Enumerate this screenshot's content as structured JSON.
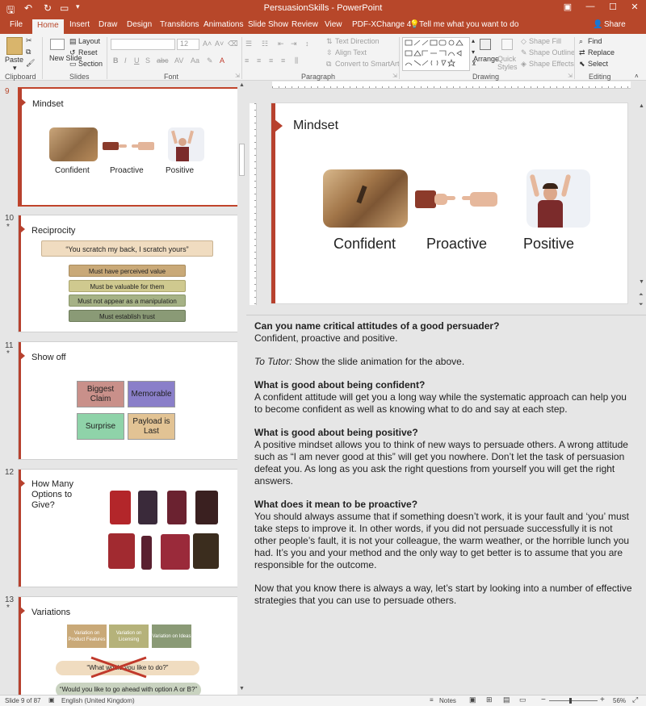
{
  "titlebar": {
    "title": "PersuasionSkills  -  PowerPoint"
  },
  "tabs": [
    "File",
    "Home",
    "Insert",
    "Draw",
    "Design",
    "Transitions",
    "Animations",
    "Slide Show",
    "Review",
    "View",
    "PDF-XChange 4"
  ],
  "tell_me": "Tell me what you want to do",
  "share": "Share",
  "ribbon": {
    "paste": "Paste",
    "new_slide": "New Slide",
    "layout": "Layout",
    "reset": "Reset",
    "section": "Section",
    "font_size": "12",
    "text_direction": "Text Direction",
    "align_text": "Align Text",
    "convert_smartart": "Convert to SmartArt",
    "arrange": "Arrange",
    "quick_styles": "Quick Styles",
    "shape_fill": "Shape Fill",
    "shape_outline": "Shape Outline",
    "shape_effects": "Shape Effects",
    "find": "Find",
    "replace": "Replace",
    "select": "Select",
    "groups": {
      "clipboard": "Clipboard",
      "slides": "Slides",
      "font": "Font",
      "paragraph": "Paragraph",
      "drawing": "Drawing",
      "editing": "Editing"
    }
  },
  "thumbnails": [
    {
      "num": "9",
      "title": "Mindset",
      "labels": [
        "Confident",
        "Proactive",
        "Positive"
      ]
    },
    {
      "num": "10",
      "star": "*",
      "title": "Reciprocity",
      "quote": "“You scratch my back, I scratch yours”",
      "items": [
        "Must have perceived value",
        "Must be valuable for them",
        "Must not appear as a manipulation",
        "Must establish trust"
      ]
    },
    {
      "num": "11",
      "star": "*",
      "title": "Show off",
      "boxes": [
        "Biggest Claim",
        "Memorable",
        "Surprise",
        "Payload is Last"
      ]
    },
    {
      "num": "12",
      "title": "How Many Options to Give?"
    },
    {
      "num": "13",
      "star": "*",
      "title": "Variations",
      "boxes": [
        "Variation on Product Features",
        "Variation on Licensing",
        "Variation on Ideas"
      ],
      "quote1": "“What would you like to do?”",
      "quote2": "“Would you like to go ahead with option A or B?”"
    }
  ],
  "slide": {
    "title": "Mindset",
    "labels": [
      "Confident",
      "Proactive",
      "Positive"
    ]
  },
  "notes": {
    "q1": "Can you name critical attitudes of a good persuader?",
    "a1": "Confident, proactive and positive.",
    "tutor_label": "To Tutor:",
    "tutor_text": " Show the slide animation for the above.",
    "q2": "What is good about being confident?",
    "a2": "A confident attitude will get you a long way while the systematic approach can help you to become confident as well as knowing what to do and say at each step.",
    "q3": "What is good about being positive?",
    "a3": "A positive mindset allows you to think of new ways to persuade others. A wrong attitude such as “I am never good at this” will get you nowhere. Don’t let the task of persuasion defeat you. As long as you ask the right questions from yourself you will get the right answers.",
    "q4": "What does it mean to be proactive?",
    "a4": "You should always assume that if something doesn’t work, it is your fault and ‘you’ must take steps to improve it. In other words, if you did not persuade successfully it is not other people’s fault, it is not your colleague, the warm weather, or the horrible lunch you had. It’s you and your method and the only way to get better is to assume that you are responsible for the outcome.",
    "p5": "Now that you know there is always a way, let’s start by looking into a number of effective strategies that you can use to persuade others."
  },
  "status": {
    "slide": "Slide 9 of 87",
    "language": "English (United Kingdom)",
    "notes": "Notes",
    "zoom": "56%"
  },
  "colors": {
    "brand": "#b7472a",
    "accent": "#b7412e"
  }
}
